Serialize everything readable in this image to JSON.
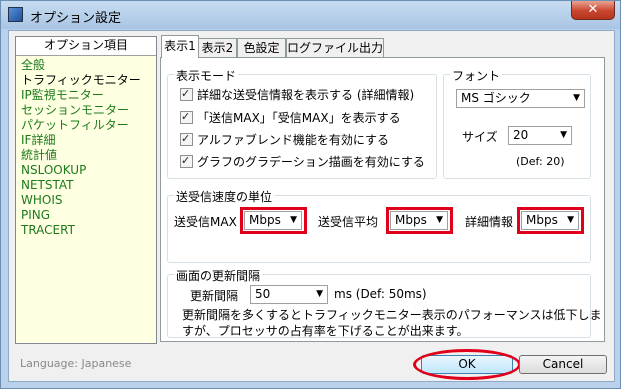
{
  "window": {
    "title": "オプション設定",
    "close_label": "✕"
  },
  "left_panel": {
    "header": "オプション項目",
    "items": [
      "全般",
      "トラフィックモニター",
      "IP監視モニター",
      "セッションモニター",
      "パケットフィルター",
      "IF詳細",
      "統計値",
      "NSLOOKUP",
      "NETSTAT",
      "WHOIS",
      "PING",
      "TRACERT"
    ],
    "selected_index": 1
  },
  "language_label": "Language: Japanese",
  "tabs": [
    "表示1",
    "表示2",
    "色設定",
    "ログファイル出力"
  ],
  "display_mode": {
    "title": "表示モード",
    "checkboxes": [
      "詳細な送受信情報を表示する (詳細情報)",
      "「送信MAX」「受信MAX」を表示する",
      "アルファブレンド機能を有効にする",
      "グラフのグラデーション描画を有効にする"
    ]
  },
  "font": {
    "title": "フォント",
    "family": "MS ゴシック",
    "size_label": "サイズ",
    "size": "20",
    "default_note": "(Def: 20)"
  },
  "speed_unit": {
    "title": "送受信速度の単位",
    "send_max_label": "送受信MAX",
    "send_max_value": "Mbps",
    "avg_label": "送受信平均",
    "avg_value": "Mbps",
    "detail_label": "詳細情報",
    "detail_value": "Mbps"
  },
  "refresh": {
    "title": "画面の更新間隔",
    "interval_label": "更新間隔",
    "interval_value": "50",
    "unit_note": "ms (Def: 50ms)",
    "note_line1": "更新間隔を多くするとトラフィックモニター表示のパフォーマンスは低下しま",
    "note_line2": "すが、プロセッサの占有率を下げることが出来ます。"
  },
  "buttons": {
    "ok": "OK",
    "cancel": "Cancel"
  },
  "colors": {
    "highlight": "#e0001b",
    "list_text": "#1c7a1c",
    "list_bg": "#ffffe1"
  }
}
